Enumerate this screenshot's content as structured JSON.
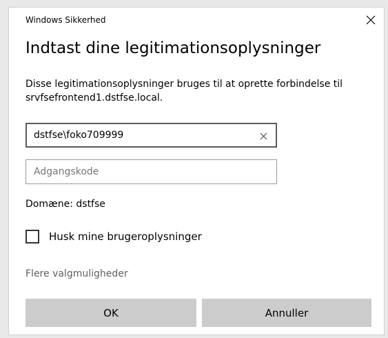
{
  "window": {
    "title": "Windows Sikkerhed",
    "close_icon": "close-icon"
  },
  "dialog": {
    "heading": "Indtast dine legitimationsoplysninger",
    "description": "Disse legitimationsoplysninger bruges til at oprette forbindelse til srvfsefrontend1.dstfse.local."
  },
  "username_field": {
    "value": "dstfse\\foko709999",
    "clear_icon": "clear-icon"
  },
  "password_field": {
    "value": "",
    "placeholder": "Adgangskode"
  },
  "domain_text": "Domæne: dstfse",
  "remember": {
    "label": "Husk mine brugeroplysninger",
    "checked": false
  },
  "more_options_label": "Flere valgmuligheder",
  "buttons": {
    "ok_label": "OK",
    "cancel_label": "Annuller"
  },
  "colors": {
    "dialog_background": "#ffffff",
    "page_background": "#e9e9e9",
    "button_background": "#cccccc",
    "link_text": "#5f5f5f",
    "placeholder_text": "#767676"
  }
}
